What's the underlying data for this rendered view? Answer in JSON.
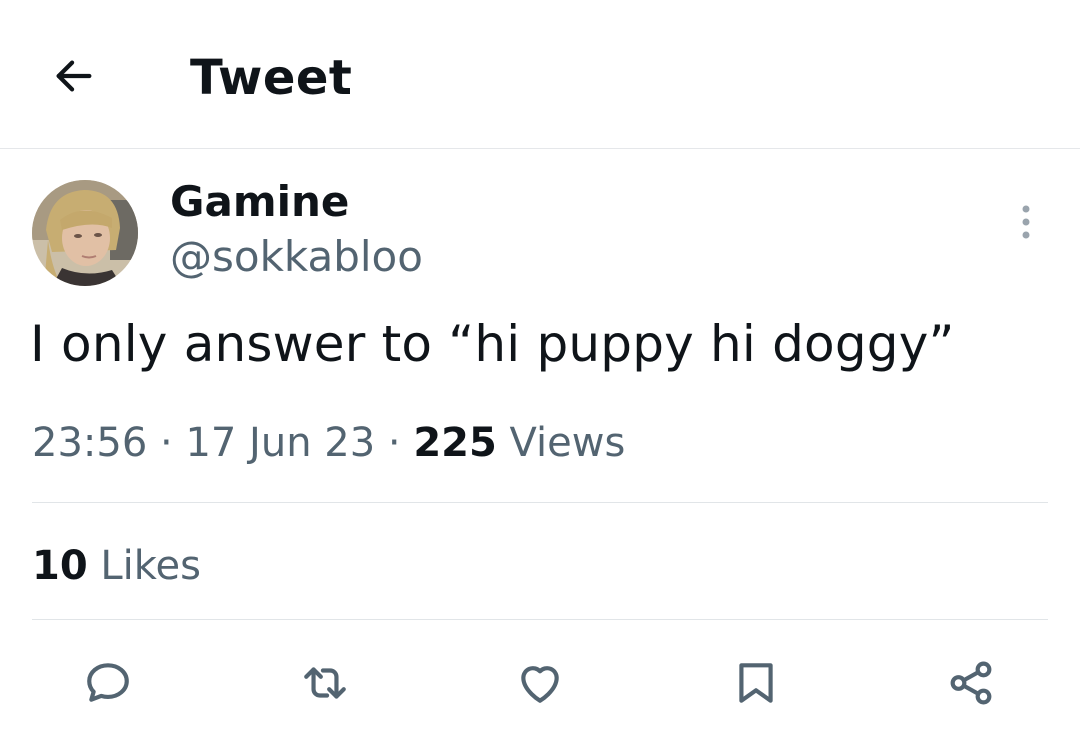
{
  "header": {
    "title": "Tweet",
    "back_icon": "arrow-left-icon"
  },
  "tweet": {
    "author": {
      "name": "Gamine",
      "handle": "@sokkabloo"
    },
    "text": "I only answer to “hi puppy hi doggy”",
    "time": "23:56",
    "date": "17 Jun 23",
    "separator": "·",
    "views_count": "225",
    "views_label": "Views",
    "likes_count": "10",
    "likes_label": "Likes"
  },
  "actions": [
    {
      "name": "reply",
      "icon": "reply-icon"
    },
    {
      "name": "retweet",
      "icon": "retweet-icon"
    },
    {
      "name": "like",
      "icon": "heart-icon"
    },
    {
      "name": "bookmark",
      "icon": "bookmark-icon"
    },
    {
      "name": "share",
      "icon": "share-icon"
    }
  ],
  "colors": {
    "text_primary": "#0f1419",
    "text_secondary": "#536471",
    "divider": "#e1e5e8"
  }
}
